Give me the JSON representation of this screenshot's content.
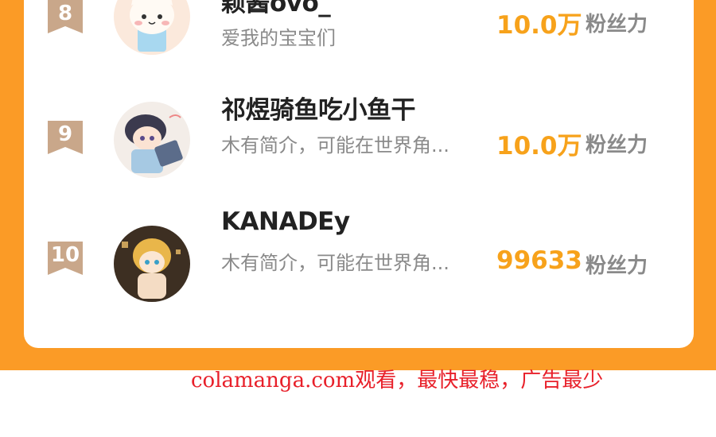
{
  "colors": {
    "background_orange": "#fb9b26",
    "fans_orange": "#f7a21b",
    "badge_tan": "#c9a78a",
    "watermark_red": "#e8202a"
  },
  "ranking": [
    {
      "rank": "8",
      "name": "颖酱ovo_",
      "desc": "爱我的宝宝们",
      "fans": "10.0万",
      "fans_label": "粉丝力",
      "avatar_icon": "cat-avatar"
    },
    {
      "rank": "9",
      "name": "祁煜骑鱼吃小鱼干",
      "desc": "木有简介，可能在世界角...",
      "fans": "10.0万",
      "fans_label": "粉丝力",
      "avatar_icon": "anime-boy-avatar"
    },
    {
      "rank": "10",
      "name": "KANADEy",
      "desc": "木有简介，可能在世界角...",
      "fans": "99633",
      "fans_label": "粉丝力",
      "avatar_icon": "anime-blonde-avatar"
    }
  ],
  "watermark": "colamanga.com观看，最快最稳，广告最少"
}
